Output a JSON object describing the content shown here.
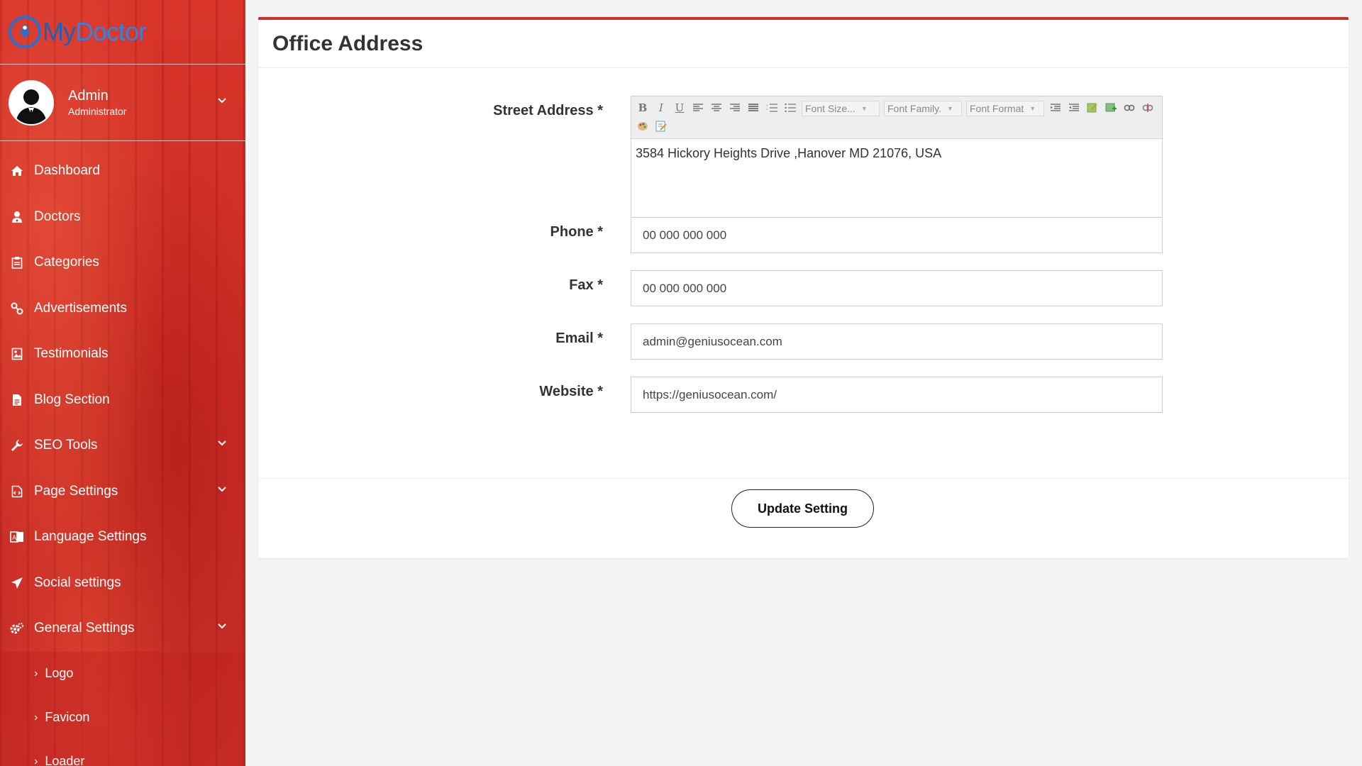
{
  "brand": {
    "name_part1": "My",
    "name_part2": "Doctor"
  },
  "user": {
    "name": "Admin",
    "role": "Administrator"
  },
  "sidebar": {
    "items": [
      {
        "label": "Dashboard",
        "icon": "home-icon"
      },
      {
        "label": "Doctors",
        "icon": "user-md-icon"
      },
      {
        "label": "Categories",
        "icon": "clipboard-icon"
      },
      {
        "label": "Advertisements",
        "icon": "link-icon"
      },
      {
        "label": "Testimonials",
        "icon": "image-icon"
      },
      {
        "label": "Blog Section",
        "icon": "file-icon"
      },
      {
        "label": "SEO Tools",
        "icon": "wrench-icon"
      },
      {
        "label": "Page Settings",
        "icon": "code-file-icon"
      },
      {
        "label": "Language Settings",
        "icon": "language-icon"
      },
      {
        "label": "Social settings",
        "icon": "paper-plane-icon"
      },
      {
        "label": "General Settings",
        "icon": "cogs-icon"
      }
    ],
    "sub_items": [
      "Logo",
      "Favicon",
      "Loader"
    ]
  },
  "page": {
    "title": "Office Address",
    "editor_toolbar": {
      "font_size": "Font Size...",
      "font_family": "Font Family.",
      "font_format": "Font Format"
    },
    "fields": {
      "street": {
        "label": "Street Address *",
        "value": "3584 Hickory Heights Drive ,Hanover MD 21076, USA"
      },
      "phone": {
        "label": "Phone *",
        "value": "00 000 000 000"
      },
      "fax": {
        "label": "Fax *",
        "value": "00 000 000 000"
      },
      "email": {
        "label": "Email *",
        "value": "admin@geniusocean.com"
      },
      "website": {
        "label": "Website *",
        "value": "https://geniusocean.com/"
      }
    },
    "submit_label": "Update Setting"
  },
  "colors": {
    "sidebar": "#cc2d24",
    "accent": "#c9302c",
    "logo_blue": "#2a6fc9"
  }
}
